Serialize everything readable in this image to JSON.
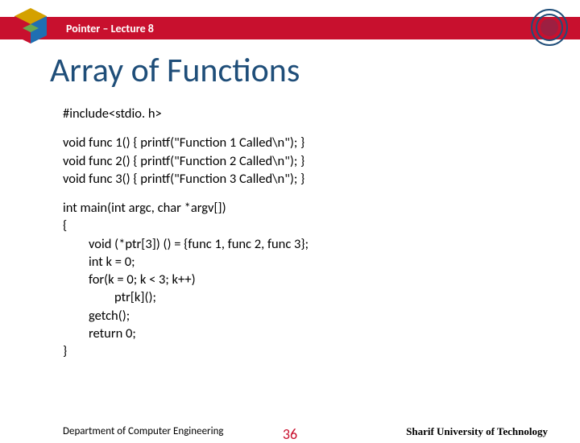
{
  "header": {
    "course_title": "Pointer – Lecture 8"
  },
  "title": "Array of Functions",
  "code": {
    "include": "#include<stdio. h>",
    "func1": "void func 1() {  printf(\"Function 1 Called\\n\"); }",
    "func2": "void func 2() {  printf(\"Function 2 Called\\n\"); }",
    "func3": "void func 3() {  printf(\"Function 3 Called\\n\"); }",
    "main_sig": "int main(int argc, char *argv[])",
    "brace_open": "{",
    "l1": "void (*ptr[3]) () = {func 1, func 2, func 3};",
    "l2": "int k = 0;",
    "l3": "for(k = 0; k < 3; k++)",
    "l4": "ptr[k]();",
    "l5": "getch();",
    "l6": "return 0;",
    "brace_close": "}"
  },
  "footer": {
    "left": "Department of Computer Engineering",
    "page": "36",
    "right": "Sharif University of Technology"
  },
  "colors": {
    "accent_red": "#c8102e",
    "title_blue": "#1f4e79"
  }
}
